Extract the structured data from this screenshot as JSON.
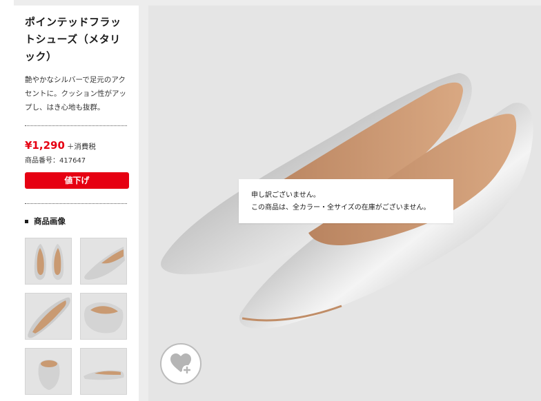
{
  "product": {
    "title": "ポインテッドフラットシューズ（メタリック）",
    "description": "艶やかなシルバーで足元のアクセントに。クッション性がアップし、はき心地も抜群。",
    "price": "¥1,290",
    "tax_label": "＋消費税",
    "product_number": "商品番号：417647",
    "sale_badge": "値下げ"
  },
  "images_section": {
    "heading": "商品画像",
    "thumbnails": [
      "pair-top-view",
      "single-side-view",
      "insole-view",
      "heel-back-view",
      "back-view",
      "profile-view"
    ]
  },
  "notice": {
    "line1": "申し訳ございません。",
    "line2": "この商品は、全カラー・全サイズの在庫がございません。"
  },
  "favorite": {
    "icon": "heart-plus-icon"
  },
  "colors": {
    "accent": "#e60012",
    "panel": "#e5e5e5",
    "silver": "#c9c9c9"
  }
}
